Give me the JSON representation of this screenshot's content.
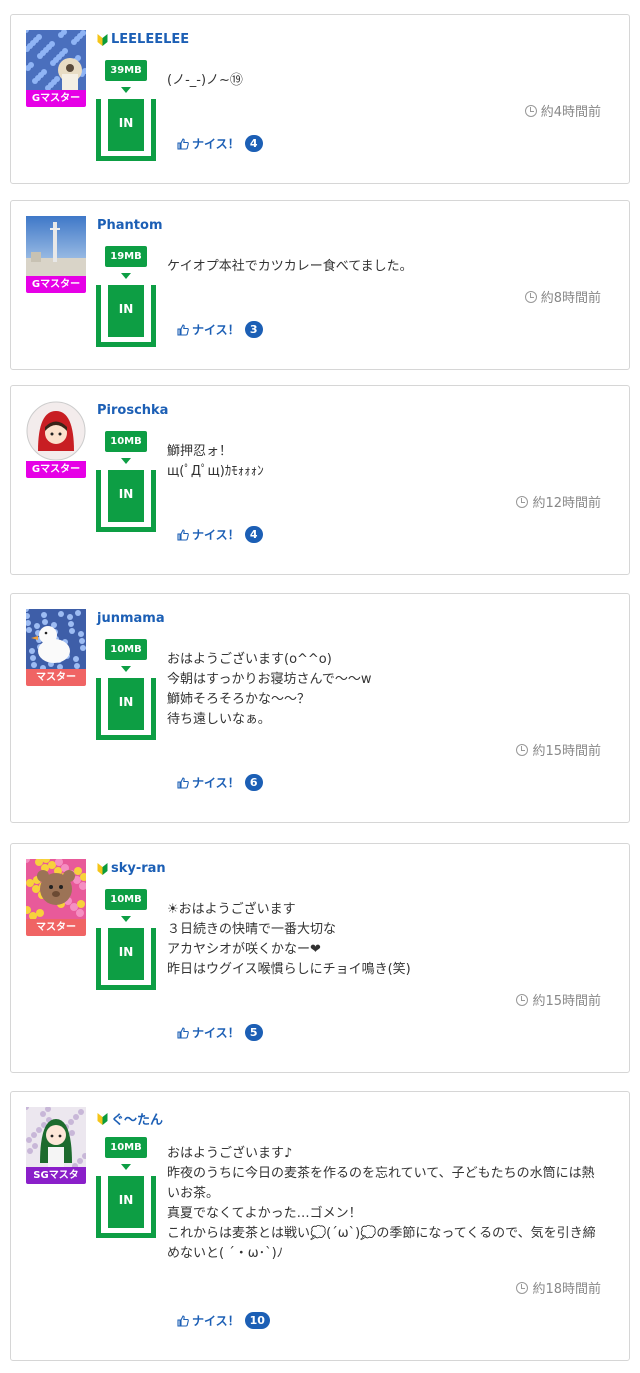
{
  "posts": [
    {
      "username": "LEELEELEE",
      "beginner": true,
      "rank": "Gマスター",
      "rank_color": "#e600e6",
      "mb": "39MB",
      "in_label": "IN",
      "message": [
        "(ノ-_-)ノ~⑲"
      ],
      "time": "約4時間前",
      "nice_label": "ナイス！",
      "nice_count": "4",
      "avatar_icon": "flower-field-avatar-icon"
    },
    {
      "username": "Phantom",
      "beginner": false,
      "rank": "Gマスター",
      "rank_color": "#e600e6",
      "mb": "19MB",
      "in_label": "IN",
      "message": [
        "ケイオプ本社でカツカレー食べてました。"
      ],
      "time": "約8時間前",
      "nice_label": "ナイス！",
      "nice_count": "3",
      "avatar_icon": "tower-sky-avatar-icon"
    },
    {
      "username": "Piroschka",
      "beginner": false,
      "rank": "Gマスター",
      "rank_color": "#e600e6",
      "mb": "10MB",
      "in_label": "IN",
      "message": [
        "鰤押忍ォ！",
        " щ(ﾟДﾟщ)ｶﾓｫｫｫﾝ"
      ],
      "time": "約12時間前",
      "nice_label": "ナイス！",
      "nice_count": "4",
      "avatar_icon": "red-hood-girl-avatar-icon"
    },
    {
      "username": "junmama",
      "beginner": false,
      "rank": "マスター",
      "rank_color": "#f06464",
      "mb": "10MB",
      "in_label": "IN",
      "message": [
        "おはようございます(o^^o)",
        "今朝はすっかりお寝坊さんで〜〜w",
        "鰤姉そろそろかな〜〜？",
        "待ち遠しいなぁ。"
      ],
      "time": "約15時間前",
      "nice_label": "ナイス！",
      "nice_count": "6",
      "avatar_icon": "duck-flowers-avatar-icon"
    },
    {
      "username": "sky-ran",
      "beginner": true,
      "rank": "マスター",
      "rank_color": "#f06464",
      "mb": "10MB",
      "in_label": "IN",
      "message": [
        "☀おはようございます",
        "３日続きの快晴で一番大切な",
        "アカヤシオが咲くかなー❤",
        "昨日はウグイス喉慣らしにチョイ鳴き(笑)"
      ],
      "time": "約15時間前",
      "nice_label": "ナイス！",
      "nice_count": "5",
      "avatar_icon": "bear-flowers-avatar-icon"
    },
    {
      "username": "ぐ〜たん",
      "beginner": true,
      "rank": "SGマスタ",
      "rank_color": "#8a1fc9",
      "mb": "10MB",
      "in_label": "IN",
      "message": [
        "おはようございます♪",
        "昨夜のうちに今日の麦茶を作るのを忘れていて、子どもたちの水筒には熱いお茶。",
        "真夏でなくてよかった…ゴメン！",
        "これからは麦茶とは戦い💭(´ω`)💭の季節になってくるので、気を引き締めないと( ´・ω･`)ﾉ"
      ],
      "time": "約18時間前",
      "nice_label": "ナイス！",
      "nice_count": "10",
      "avatar_icon": "green-hair-girl-avatar-icon"
    }
  ]
}
